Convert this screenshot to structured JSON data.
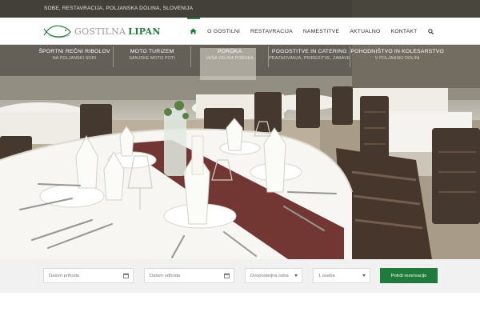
{
  "topbar": {
    "text": "SOBE, RESTAVRACIJA, POLJANSKA DOLINA, SLOVENIJA"
  },
  "logo": {
    "text_a": "GOSTILNA",
    "text_b": "LIPAN"
  },
  "nav": {
    "home_icon": "home-icon",
    "items": [
      "O GOSTILNI",
      "RESTAVRACIJA",
      "NAMESTITVE",
      "AKTUALNO",
      "KONTAKT"
    ],
    "search_icon": "search-icon",
    "active_index": 0
  },
  "features": [
    {
      "title": "ŠPORTNI REČNI RIBOLOV",
      "subtitle": "NA POLJANSKI SORI"
    },
    {
      "title": "MOTO TURIZEM",
      "subtitle": "SANJSKE MOTO POTI"
    },
    {
      "title": "POROKA",
      "subtitle": "VAŠA VELIKA POROKA"
    },
    {
      "title": "POGOSTITVE IN CATERING",
      "subtitle": "PRAZNOVANJA, PRIREDITVE, ZABAVE"
    },
    {
      "title": "POHODNIŠTVO IN KOLESARSTVO",
      "subtitle": "V POLJANSKI DOLINI"
    }
  ],
  "booking": {
    "arrival_placeholder": "Datum prihoda",
    "departure_placeholder": "Datum odhoda",
    "room_value": "Dvoposteljna soba",
    "guests_value": "1 oseba",
    "submit_label": "Potrdi rezervacijo",
    "calendar_icon": "calendar-icon"
  },
  "colors": {
    "brand_green": "#1f7a3c",
    "topbar": "#28262299"
  }
}
